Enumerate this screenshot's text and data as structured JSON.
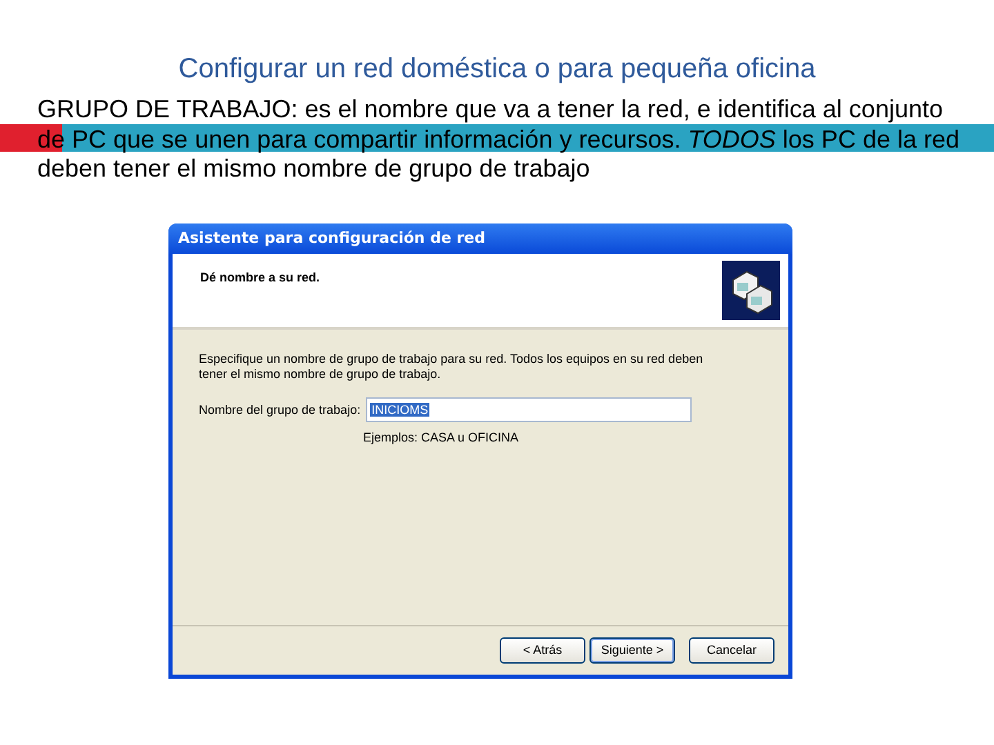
{
  "slide": {
    "title": "Configurar un red doméstica o para pequeña oficina",
    "body": "GRUPO DE TRABAJO: es el nombre que va a tener la red, e identifica al conjunto de PC que se unen para compartir información y recursos. *TODOS* los PC de la red deben tener el mismo nombre de grupo de trabajo"
  },
  "dialog": {
    "title": "Asistente para configuración de red",
    "heading": "Dé nombre a su red.",
    "instructions": "Especifique un nombre de grupo de trabajo para su red. Todos los equipos en su red deben tener el mismo nombre de grupo de trabajo.",
    "field": {
      "label": "Nombre del grupo de trabajo:",
      "value": "INICIOMS",
      "highlighted": true
    },
    "hint": "Ejemplos: CASA u OFICINA",
    "buttons": [
      {
        "label": "< Atrás",
        "default": false
      },
      {
        "label": "Siguiente >",
        "default": true
      },
      {
        "label": "Cancelar",
        "default": false
      }
    ]
  }
}
